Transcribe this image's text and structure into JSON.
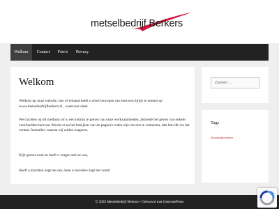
{
  "header": {
    "logo_text": "metselbedrijf Berkers",
    "logo_swoosh_color": "#d4143c"
  },
  "nav": {
    "items": [
      {
        "label": "Welkom",
        "active": true
      },
      {
        "label": "Contact",
        "active": false
      },
      {
        "label": "Foto's",
        "active": false
      },
      {
        "label": "Privacy",
        "active": false
      }
    ]
  },
  "main": {
    "title": "Welkom",
    "paragraphs": [
      "Welkom op onze website, iets of iemand heeft u ertoe bewogen om eens een kijkje te nemen op www.metselbedrijfberkers.nl , waarvoor dank.",
      "We trachten op dit medium om u een indruk te geven van onze werkzaamheden, alsmede het geven van enkele voorbeelden hiervan. Mocht er na het bekijken van de pagina's reden zijn om ons te contacten, dan kan dit via het contact formulier, waarna wij zullen reageren.",
      "Kijk gerust rond en heeft u vragen stel ze ons,",
      "Heeft u klachten zegt het ons, bent u tevreden zegt het voort!"
    ]
  },
  "sidebar": {
    "search_placeholder": "Zoeken …",
    "tags_title": "Tags",
    "tags": [
      "Kiezdpolset almere"
    ]
  },
  "footer": {
    "text": "© 2025 Metselbedrijf Berkers • Gebouwd met GeneratePress"
  },
  "colors": {
    "nav_background": "#222222",
    "nav_active": "#3f3f3f",
    "page_background": "#efefef",
    "tag_link": "#c01a2a",
    "footer_background": "#222222"
  },
  "icons": {
    "logo": "red-swoosh-logo",
    "recaptcha": "recaptcha-icon"
  }
}
